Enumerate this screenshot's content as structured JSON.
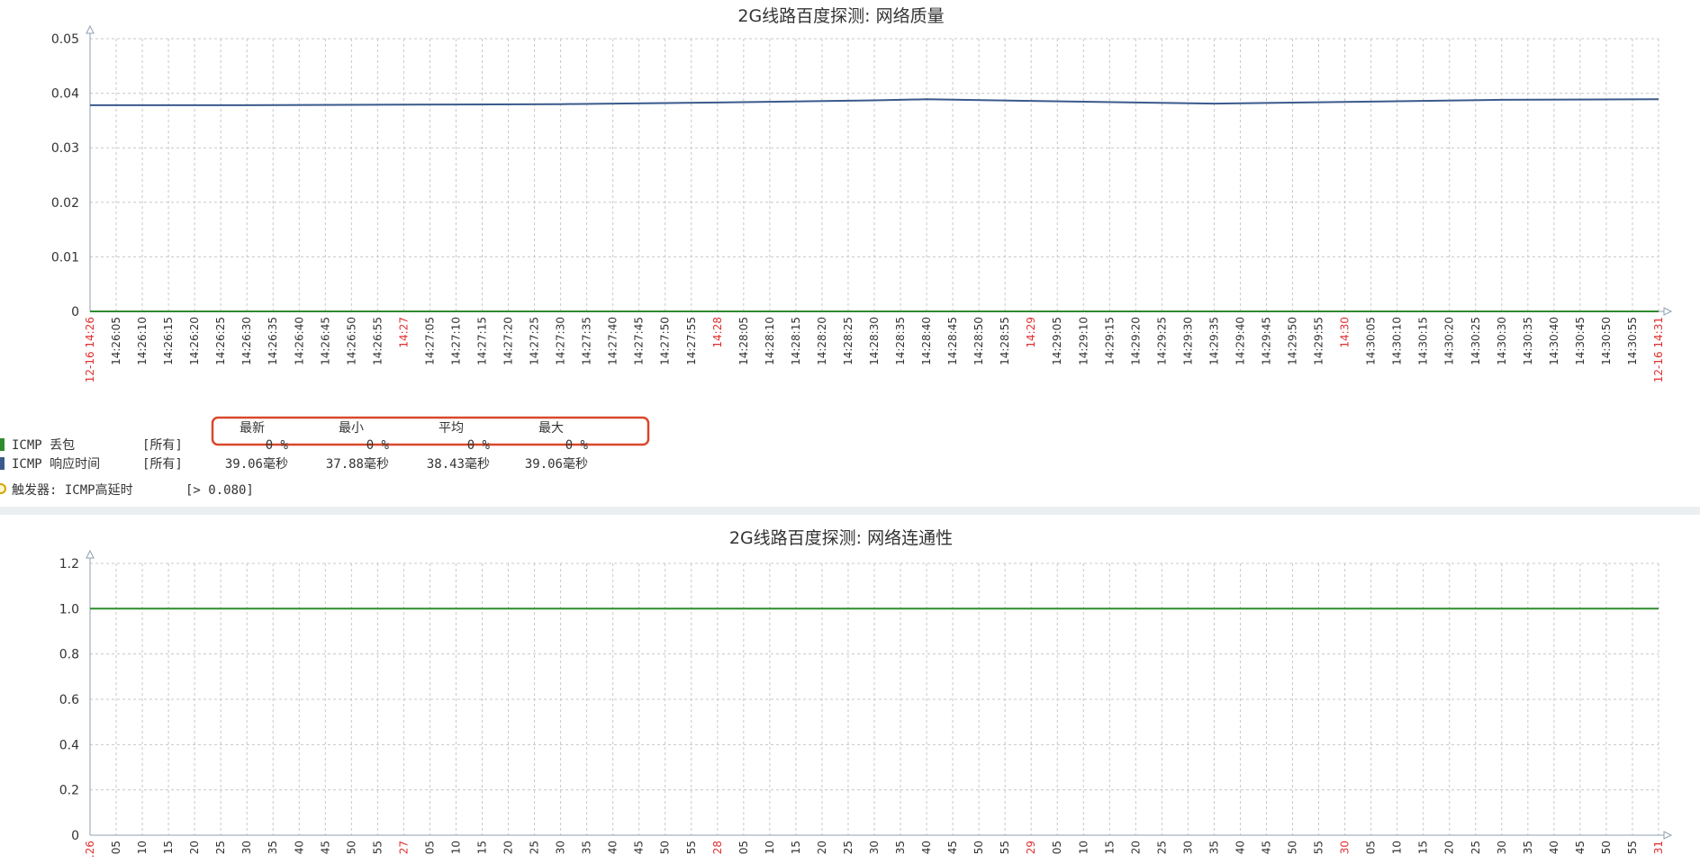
{
  "colors": {
    "loss_series": "#2e8b2e",
    "response_series": "#3a5a8c",
    "trigger_marker": "#d4a400",
    "major_tick": "#e03030",
    "highlight_box": "#d9482b"
  },
  "chart_data": [
    {
      "type": "line",
      "title": "2G线路百度探测: 网络质量",
      "ylim": [
        0,
        0.05
      ],
      "yticks": [
        "0.05",
        "0.04",
        "0.03",
        "0.02",
        "0.01",
        "0"
      ],
      "ytick_values": [
        0.05,
        0.04,
        0.03,
        0.02,
        0.01,
        0
      ],
      "xlabels": [
        "12-16 14:26",
        "14:26:05",
        "14:26:10",
        "14:26:15",
        "14:26:20",
        "14:26:25",
        "14:26:30",
        "14:26:35",
        "14:26:40",
        "14:26:45",
        "14:26:50",
        "14:26:55",
        "14:27",
        "14:27:05",
        "14:27:10",
        "14:27:15",
        "14:27:20",
        "14:27:25",
        "14:27:30",
        "14:27:35",
        "14:27:40",
        "14:27:45",
        "14:27:50",
        "14:27:55",
        "14:28",
        "14:28:05",
        "14:28:10",
        "14:28:15",
        "14:28:20",
        "14:28:25",
        "14:28:30",
        "14:28:35",
        "14:28:40",
        "14:28:45",
        "14:28:50",
        "14:28:55",
        "14:29",
        "14:29:05",
        "14:29:10",
        "14:29:15",
        "14:29:20",
        "14:29:25",
        "14:29:30",
        "14:29:35",
        "14:29:40",
        "14:29:45",
        "14:29:50",
        "14:29:55",
        "14:30",
        "14:30:05",
        "14:30:10",
        "14:30:15",
        "14:30:20",
        "14:30:25",
        "14:30:30",
        "14:30:35",
        "14:30:40",
        "14:30:45",
        "14:30:50",
        "14:30:55",
        "12-16 14:31"
      ],
      "grid": true,
      "series": [
        {
          "color_key": "response_series",
          "points": [
            [
              0,
              0.0378
            ],
            [
              6,
              0.0378
            ],
            [
              12,
              0.0379
            ],
            [
              18,
              0.038
            ],
            [
              24,
              0.0383
            ],
            [
              30,
              0.0387
            ],
            [
              32,
              0.0389
            ],
            [
              36,
              0.0386
            ],
            [
              40,
              0.0383
            ],
            [
              43,
              0.0381
            ],
            [
              48,
              0.0384
            ],
            [
              54,
              0.0388
            ],
            [
              60,
              0.0389
            ]
          ]
        },
        {
          "color_key": "loss_series",
          "points": [
            [
              0,
              0
            ],
            [
              60,
              0
            ]
          ]
        }
      ]
    },
    {
      "type": "line",
      "title": "2G线路百度探测: 网络连通性",
      "ylim": [
        0,
        1.2
      ],
      "yticks": [
        "1.2",
        "1.0",
        "0.8",
        "0.6",
        "0.4",
        "0.2",
        "0"
      ],
      "ytick_values": [
        1.2,
        1.0,
        0.8,
        0.6,
        0.4,
        0.2,
        0
      ],
      "xlabels": [
        ".26",
        "05",
        "10",
        "15",
        "20",
        "25",
        "30",
        "35",
        "40",
        "45",
        "50",
        "55",
        "27",
        "05",
        "10",
        "15",
        "20",
        "25",
        "30",
        "35",
        "40",
        "45",
        "50",
        "55",
        "28",
        "05",
        "10",
        "15",
        "20",
        "25",
        "30",
        "35",
        "40",
        "45",
        "50",
        "55",
        "29",
        "05",
        "10",
        "15",
        "20",
        "25",
        "30",
        "35",
        "40",
        "45",
        "50",
        "55",
        "30",
        "05",
        "10",
        "15",
        "20",
        "25",
        "30",
        "35",
        "40",
        "45",
        "50",
        "55",
        "31"
      ],
      "grid": true,
      "series": [
        {
          "color_key": "loss_series",
          "points": [
            [
              0,
              1.0
            ],
            [
              60,
              1.0
            ]
          ]
        }
      ]
    }
  ],
  "legend": {
    "headers": [
      "最新",
      "最小",
      "平均",
      "最大"
    ],
    "rows": [
      {
        "name": "ICMP 丢包",
        "scope": "[所有]",
        "values": [
          "0 %",
          "0 %",
          "0 %",
          "0 %"
        ],
        "color_key": "loss_series"
      },
      {
        "name": "ICMP 响应时间",
        "scope": "[所有]",
        "values": [
          "39.06毫秒",
          "37.88毫秒",
          "38.43毫秒",
          "39.06毫秒"
        ],
        "color_key": "response_series"
      }
    ],
    "trigger": {
      "label": "触发器: ICMP高延时",
      "threshold": "[> 0.080]"
    }
  }
}
